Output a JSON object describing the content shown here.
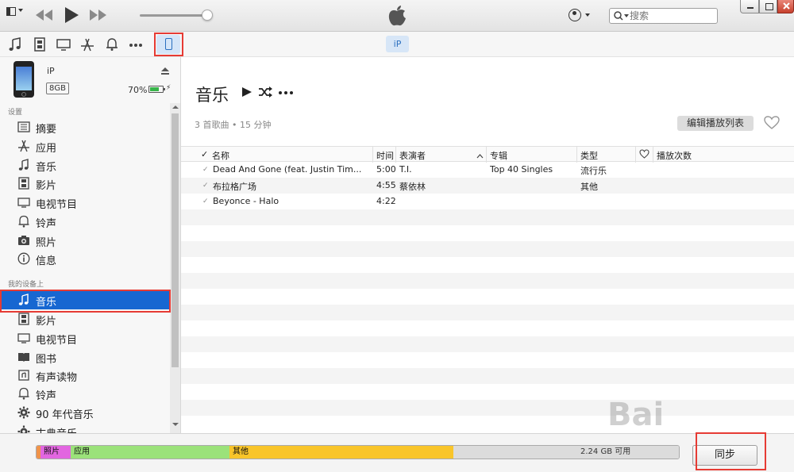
{
  "toolbar": {
    "search_placeholder": "搜索"
  },
  "mediabar": {
    "device_pill": "iP"
  },
  "device": {
    "name": "iP",
    "capacity": "8GB",
    "battery": "70%",
    "battery_level": 0.7,
    "charging_symbol": "⚡"
  },
  "sidebar": {
    "settings_label": "设置",
    "settings_items": [
      {
        "label": "摘要",
        "icon": "summary-icon"
      },
      {
        "label": "应用",
        "icon": "apps-icon"
      },
      {
        "label": "音乐",
        "icon": "music-icon"
      },
      {
        "label": "影片",
        "icon": "film-icon"
      },
      {
        "label": "电视节目",
        "icon": "tv-icon"
      },
      {
        "label": "铃声",
        "icon": "bell-icon"
      },
      {
        "label": "照片",
        "icon": "camera-icon"
      },
      {
        "label": "信息",
        "icon": "info-icon"
      }
    ],
    "device_label": "我的设备上",
    "device_items": [
      {
        "label": "音乐",
        "icon": "music-icon",
        "selected": true
      },
      {
        "label": "影片",
        "icon": "film-icon"
      },
      {
        "label": "电视节目",
        "icon": "tv-icon"
      },
      {
        "label": "图书",
        "icon": "book-icon"
      },
      {
        "label": "有声读物",
        "icon": "audiobook-icon"
      },
      {
        "label": "铃声",
        "icon": "bell-icon"
      },
      {
        "label": "90 年代音乐",
        "icon": "gear-icon"
      },
      {
        "label": "古典音乐",
        "icon": "gear-icon"
      }
    ]
  },
  "main": {
    "title": "音乐",
    "summary": "3 首歌曲 • 15 分钟",
    "edit_playlist": "编辑播放列表",
    "columns": {
      "check": "✓",
      "name": "名称",
      "time": "时间",
      "artist": "表演者",
      "album": "专辑",
      "genre": "类型",
      "plays": "播放次数"
    },
    "songs": [
      {
        "name": "Dead And Gone (feat. Justin Tim...",
        "time": "5:00",
        "artist": "T.I.",
        "album": "Top 40 Singles",
        "genre": "流行乐"
      },
      {
        "name": "布拉格广场",
        "time": "4:55",
        "artist": "蔡依林",
        "album": "",
        "genre": "其他"
      },
      {
        "name": "Beyonce - Halo",
        "time": "4:22",
        "artist": "",
        "album": "",
        "genre": ""
      }
    ]
  },
  "storage": {
    "segments": [
      {
        "label": "照片",
        "color": "#e266e0"
      },
      {
        "label": "应用",
        "color": "#9be27a"
      },
      {
        "label": "其他",
        "color": "#f9c52a"
      }
    ],
    "free_label": "2.24 GB 可用",
    "free_color": "#dcdcdc"
  },
  "sync_button": "同步",
  "colors": {
    "accent": "#1767d1",
    "highlight": "#e63b34"
  }
}
